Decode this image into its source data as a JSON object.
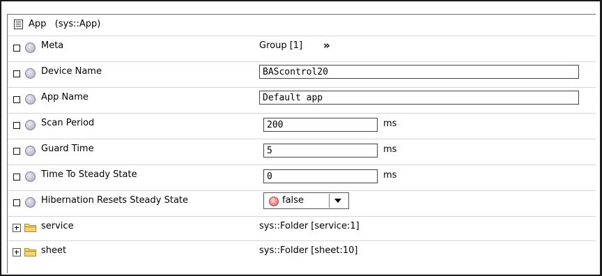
{
  "panel": {
    "title": "App   (sys::App)",
    "title_icon": "property-sheet-icon"
  },
  "rows": [
    {
      "name": "Meta",
      "value": "Group [1]",
      "action_icon": "double-chevron-right-icon"
    },
    {
      "name": "Device Name",
      "value": "BAScontrol20"
    },
    {
      "name": "App Name",
      "value": "Default app"
    },
    {
      "name": "Scan Period",
      "value": "200",
      "unit": "ms"
    },
    {
      "name": "Guard Time",
      "value": "5",
      "unit": "ms"
    },
    {
      "name": "Time To Steady State",
      "value": "0",
      "unit": "ms"
    },
    {
      "name": "Hibernation Resets Steady State",
      "value": "false"
    },
    {
      "name": "service",
      "value": "sys::Folder [service:1]"
    },
    {
      "name": "sheet",
      "value": "sys::Folder [sheet:10]"
    }
  ],
  "colors": {
    "slot_dot": "#c6c6d4",
    "false_dot": "#f08a8a",
    "folder": "#f3d36e",
    "border": "#d6d6d6"
  }
}
